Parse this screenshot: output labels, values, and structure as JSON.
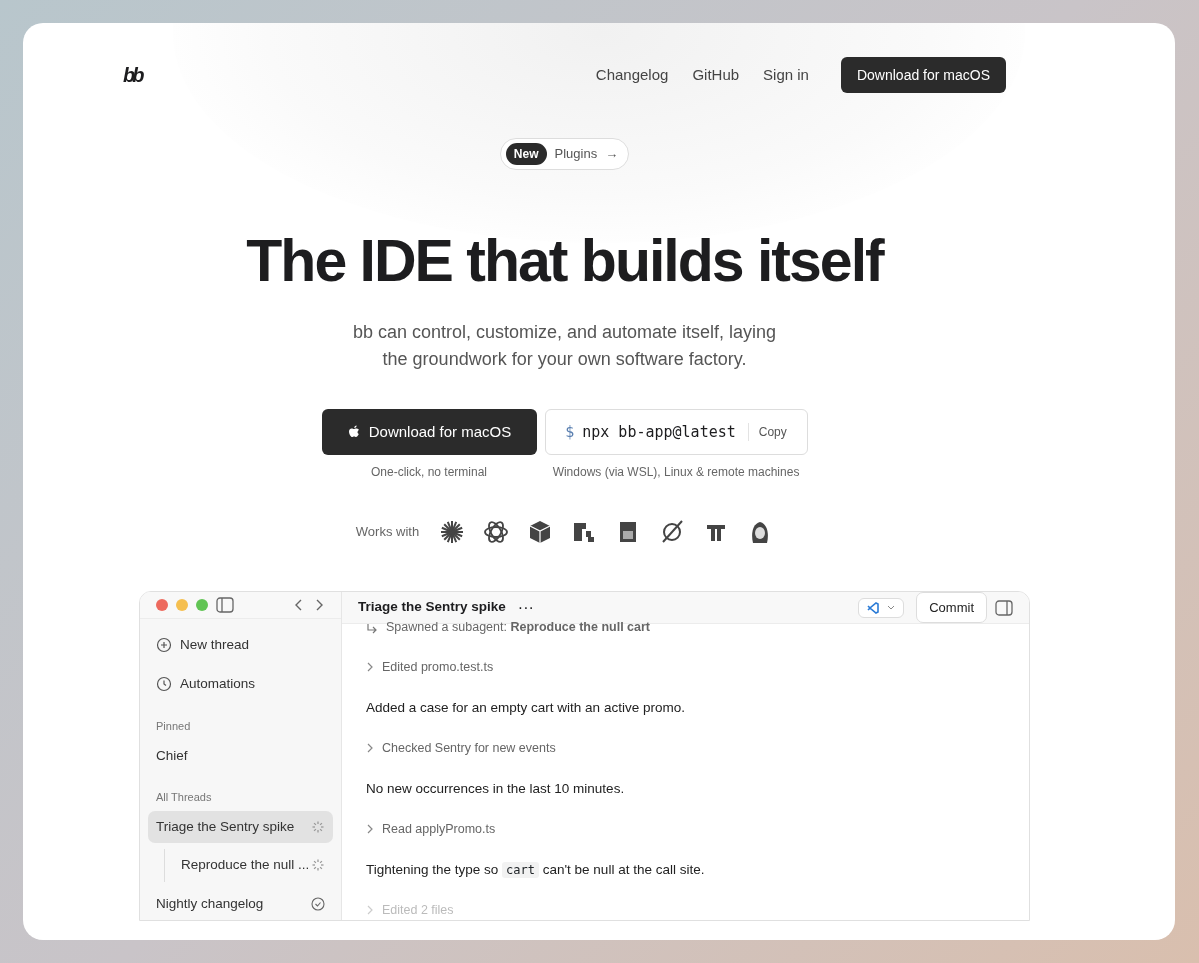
{
  "nav": {
    "logo": "bb",
    "links": [
      "Changelog",
      "GitHub",
      "Sign in"
    ],
    "cta": "Download for macOS"
  },
  "announcement": {
    "badge": "New",
    "label": "Plugins",
    "arrow": "→"
  },
  "hero": {
    "title": "The IDE that builds itself",
    "subtitle": "bb can control, customize, and automate itself, laying the groundwork for your own software factory."
  },
  "install": {
    "download": {
      "label": "Download for macOS",
      "caption": "One-click, no terminal"
    },
    "command": {
      "prompt": "$",
      "text": "npx bb-app@latest",
      "copy": "Copy",
      "caption": "Windows (via WSL), Linux & remote machines"
    }
  },
  "works_with": {
    "label": "Works with"
  },
  "app": {
    "thread_title": "Triage the Sentry spike",
    "more": "···",
    "commit": "Commit",
    "sidebar": {
      "actions": [
        {
          "kind": "new",
          "label": "New thread"
        },
        {
          "kind": "automations",
          "label": "Automations"
        }
      ],
      "sections": [
        {
          "title": "Pinned",
          "items": [
            {
              "label": "Chief",
              "kind": "plain",
              "selected": false
            }
          ]
        },
        {
          "title": "All Threads",
          "items": [
            {
              "label": "Triage the Sentry spike",
              "kind": "running",
              "selected": true,
              "children": [
                {
                  "label": "Reproduce the null ...",
                  "kind": "running",
                  "selected": false
                }
              ]
            },
            {
              "label": "Nightly changelog",
              "kind": "done",
              "selected": false
            }
          ]
        }
      ]
    },
    "activity": [
      {
        "kind": "subagent",
        "text": "Spawned a subagent: **Reproduce the null cart**"
      },
      {
        "kind": "step",
        "text": "Edited promo.test.ts",
        "dimmed": false
      },
      {
        "kind": "message",
        "parts": [
          {
            "kind": "text",
            "text": "Added a case for an empty cart with an active promo."
          }
        ]
      },
      {
        "kind": "step",
        "text": "Checked Sentry for new events",
        "dimmed": false
      },
      {
        "kind": "message",
        "parts": [
          {
            "kind": "text",
            "text": "No new occurrences in the last 10 minutes."
          }
        ]
      },
      {
        "kind": "step",
        "text": "Read applyPromo.ts",
        "dimmed": false
      },
      {
        "kind": "message",
        "parts": [
          {
            "kind": "text",
            "text": "Tightening the type so "
          },
          {
            "kind": "code",
            "text": "cart"
          },
          {
            "kind": "text",
            "text": " can't be null at the call site."
          }
        ]
      },
      {
        "kind": "step",
        "text": "Edited 2 files",
        "dimmed": true
      }
    ]
  }
}
